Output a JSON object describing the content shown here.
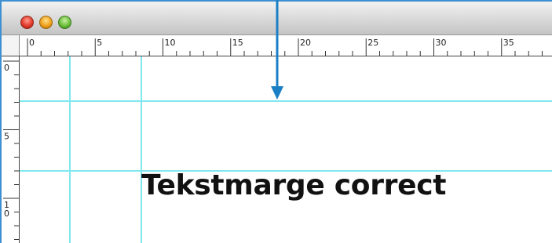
{
  "window": {
    "accent_color": "#3f8fd2",
    "guide_color": "#7fe8ee",
    "traffic_lights": [
      "close-button",
      "minimize-button",
      "zoom-button"
    ]
  },
  "ruler": {
    "horizontal_labels": [
      "0",
      "5",
      "10",
      "15",
      "20",
      "25",
      "30",
      "35"
    ],
    "vertical_labels": [
      "0",
      "5",
      "10"
    ]
  },
  "document": {
    "text": "Tekstmarge correct"
  },
  "annotation": {
    "icon": "arrow-down-icon",
    "color": "#1a7fc4"
  }
}
